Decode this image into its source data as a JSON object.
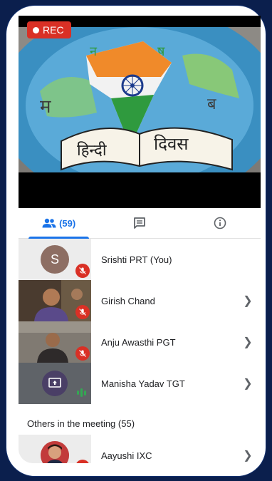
{
  "recording": {
    "label": "REC"
  },
  "video": {
    "map_letters": [
      "म",
      "न",
      "ष",
      "ब"
    ],
    "book_left": "हिन्दी",
    "book_right": "दिवस"
  },
  "tabs": [
    {
      "icon": "people-icon",
      "label": "(59)",
      "active": true
    },
    {
      "icon": "chat-icon",
      "active": false
    },
    {
      "icon": "info-icon",
      "active": false
    }
  ],
  "participants": [
    {
      "name": "Srishti PRT (You)",
      "avatar_initial": "S",
      "muted": true,
      "has_chevron": false
    },
    {
      "name": "Girish Chand",
      "muted": true,
      "has_chevron": true
    },
    {
      "name": "Anju Awasthi PGT",
      "muted": true,
      "has_chevron": true
    },
    {
      "name": "Manisha Yadav TGT",
      "presenting": true,
      "speaking": true,
      "has_chevron": true
    }
  ],
  "others_section": {
    "label": "Others in the meeting (55)"
  },
  "others": [
    {
      "name": "Aayushi IXC",
      "muted": true,
      "has_chevron": true
    }
  ],
  "colors": {
    "accent": "#1a73e8",
    "mute_red": "#d93025",
    "background": "#0b1f4d",
    "speaking_green": "#34a853"
  }
}
